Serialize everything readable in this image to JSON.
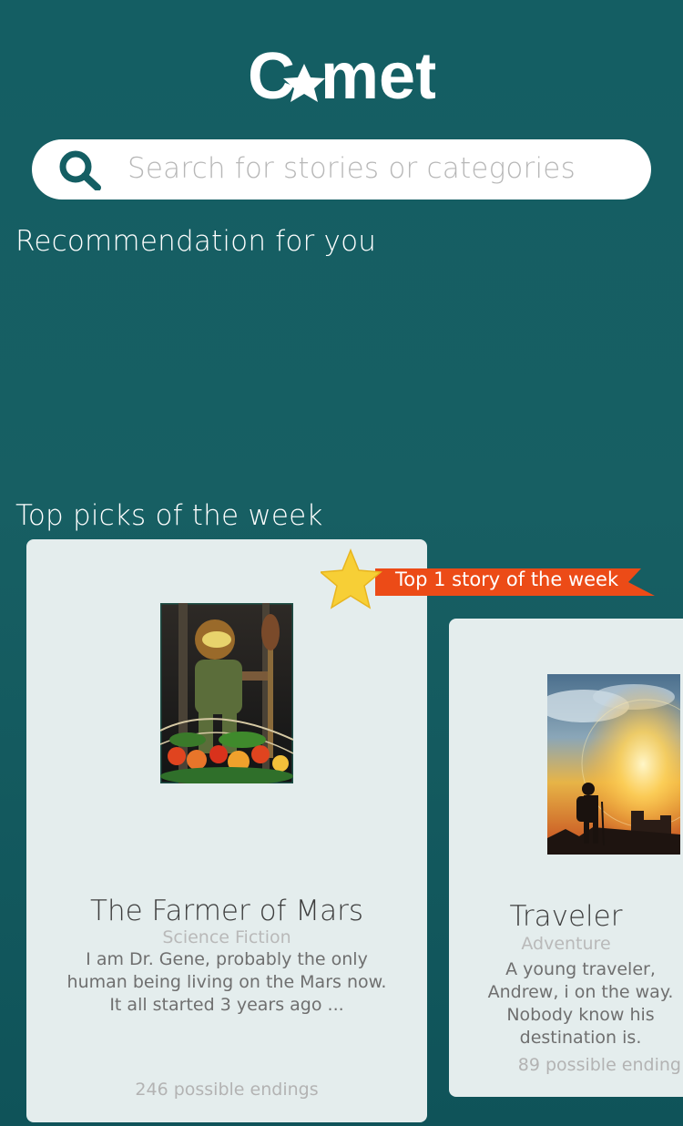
{
  "app": {
    "logo_text": "Comet"
  },
  "search": {
    "placeholder": "Search for stories or categories"
  },
  "sections": {
    "recommendation_title": "Recommendation for you",
    "top_picks_title": "Top picks of the week"
  },
  "badge": {
    "label": "Top 1 story of the week"
  },
  "stories": [
    {
      "title": "The Farmer of Mars",
      "category": "Science Fiction",
      "description": "I am Dr. Gene, probably the only human being living on the Mars now. It all started 3 years ago ...",
      "endings": "246 possible endings"
    },
    {
      "title": "Traveler",
      "category": "Adventure",
      "description": "A young traveler, Andrew, i on the way. Nobody know his destination is.",
      "endings": "89 possible ending"
    }
  ],
  "colors": {
    "background": "#145e63",
    "card": "#e4eded",
    "ribbon": "#ec4b17",
    "star": "#f7cf36",
    "search_icon": "#145e63"
  }
}
